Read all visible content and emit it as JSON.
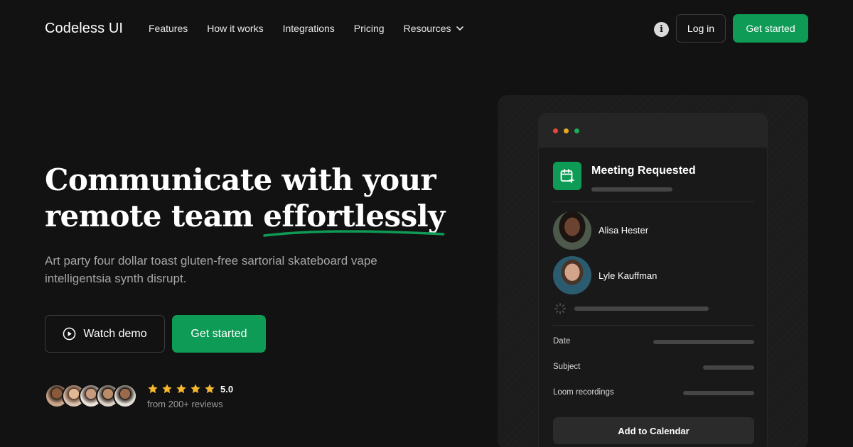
{
  "brand": "Codeless UI",
  "nav": {
    "links": [
      "Features",
      "How it works",
      "Integrations",
      "Pricing"
    ],
    "resources_label": "Resources",
    "login_label": "Log in",
    "cta_label": "Get started"
  },
  "hero": {
    "title_line1": "Communicate with your",
    "title_line2_start": "remote team ",
    "title_highlight": "effortlessly",
    "subtitle": "Art party four dollar toast gluten-free sartorial skateboard vape intelligentsia synth disrupt.",
    "demo_label": "Watch demo",
    "start_label": "Get started",
    "rating": "5.0",
    "stars": 5,
    "reviews": "from 200+ reviews"
  },
  "card": {
    "title": "Meeting Requested",
    "people": [
      "Alisa Hester",
      "Lyle Kauffman"
    ],
    "fields": [
      "Date",
      "Subject",
      "Loom recordings"
    ],
    "button_label": "Add to Calendar"
  },
  "colors": {
    "background": "#121212",
    "accent": "#0e9b55",
    "star": "#f5b82e",
    "window_red": "#e5483b",
    "window_yellow": "#e8a922",
    "window_green": "#1eaa58"
  },
  "icons": [
    "info-icon",
    "chevron-down-icon",
    "play-icon",
    "star-icon",
    "calendar-plus-icon",
    "spinner-icon"
  ]
}
